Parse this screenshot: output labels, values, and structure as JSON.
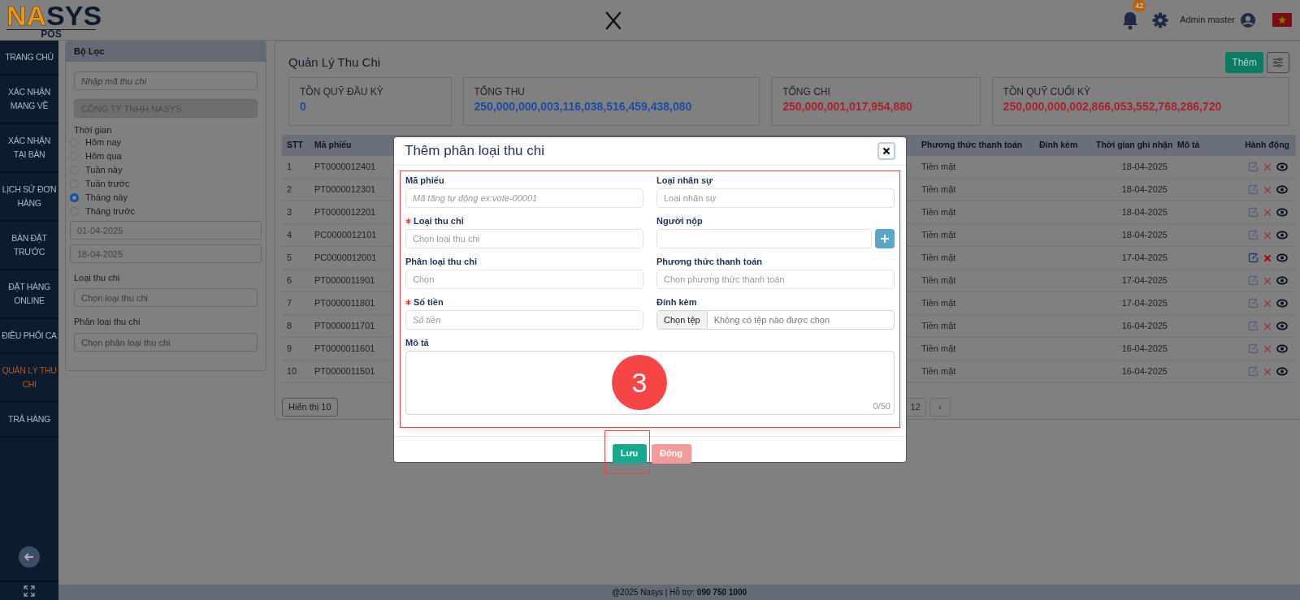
{
  "header": {
    "logo": {
      "wordmark": "NASYS",
      "sub": "POS"
    },
    "notification_count": "42",
    "user_name": "Admin master"
  },
  "sidebar": {
    "items": [
      {
        "label": "TRANG CHỦ",
        "selected": false
      },
      {
        "label": "XÁC NHẬN MANG VỀ",
        "selected": false
      },
      {
        "label": "XÁC NHẬN TẠI BÀN",
        "selected": false
      },
      {
        "label": "LỊCH SỬ ĐƠN HÀNG",
        "selected": false
      },
      {
        "label": "BÀN ĐẶT TRƯỚC",
        "selected": false
      },
      {
        "label": "ĐẶT HÀNG ONLINE",
        "selected": false
      },
      {
        "label": "ĐIỀU PHỐI CA",
        "selected": false
      },
      {
        "label": "QUẢN LÝ THU CHI",
        "selected": true
      },
      {
        "label": "TRẢ HÀNG",
        "selected": false
      }
    ]
  },
  "filter": {
    "title": "Bộ Lọc",
    "code_field": {
      "placeholder": "Nhập mã thu chi"
    },
    "company_field": {
      "value": "CÔNG TY TNHH NASYS",
      "disabled": true
    },
    "time_label": "Thời gian",
    "time_options": [
      {
        "label": "Hôm nay",
        "selected": false
      },
      {
        "label": "Hôm qua",
        "selected": false
      },
      {
        "label": "Tuần này",
        "selected": false
      },
      {
        "label": "Tuần trước",
        "selected": false
      },
      {
        "label": "Tháng này",
        "selected": true
      },
      {
        "label": "Tháng trước",
        "selected": false
      }
    ],
    "date_from": "01-04-2025",
    "date_to": "18-04-2025",
    "type": {
      "label": "Loại thu chi",
      "placeholder": "Chọn loại thu chi"
    },
    "category": {
      "label": "Phân loại thu chi",
      "placeholder": "Chọn phân loại thu chi"
    }
  },
  "main": {
    "title": "Quản Lý Thu Chi",
    "add_button": "Thêm",
    "stats": [
      {
        "label": "TỒN QUỸ ĐẦU KỲ",
        "value": "0",
        "color": "#1b4ea0"
      },
      {
        "label": "TỔNG THU",
        "value": "250,000,000,003,116,038,516,459,438,080",
        "color": "#1b4ea0"
      },
      {
        "label": "TỔNG CHI",
        "value": "250,000,001,017,954,880",
        "color": "#a8242d"
      },
      {
        "label": "TỒN QUỸ CUỐI KỲ",
        "value": "250,000,000,002,866,053,552,768,286,720",
        "color": "#a8242d"
      }
    ],
    "table": {
      "columns": [
        "STT",
        "Mã phiếu",
        "Phương thức thanh toán",
        "Đính kèm",
        "Thời gian ghi nhận",
        "Mô tả",
        "Hành động"
      ],
      "rows": [
        {
          "stt": "1",
          "code": "PT0000012401",
          "payment": "Tiền mặt",
          "recorded": "18-04-2025",
          "hovered": false
        },
        {
          "stt": "2",
          "code": "PT0000012301",
          "payment": "Tiền mặt",
          "recorded": "18-04-2025",
          "hovered": false
        },
        {
          "stt": "3",
          "code": "PT0000012201",
          "payment": "Tiền mặt",
          "recorded": "18-04-2025",
          "hovered": false
        },
        {
          "stt": "4",
          "code": "PC0000012101",
          "payment": "Tiền mặt",
          "recorded": "18-04-2025",
          "hovered": false
        },
        {
          "stt": "5",
          "code": "PC0000012001",
          "payment": "Tiền mặt",
          "recorded": "17-04-2025",
          "hovered": true
        },
        {
          "stt": "6",
          "code": "PT0000011901",
          "payment": "Tiền mặt",
          "recorded": "17-04-2025",
          "hovered": false
        },
        {
          "stt": "7",
          "code": "PT0000011801",
          "payment": "Tiền mặt",
          "recorded": "17-04-2025",
          "hovered": false
        },
        {
          "stt": "8",
          "code": "PT0000011701",
          "payment": "Tiền mặt",
          "recorded": "16-04-2025",
          "hovered": false
        },
        {
          "stt": "9",
          "code": "PT0000011601",
          "payment": "Tiền mặt",
          "recorded": "16-04-2025",
          "hovered": false
        },
        {
          "stt": "10",
          "code": "PT0000011501",
          "payment": "Tiền mặt",
          "recorded": "16-04-2025",
          "hovered": false
        }
      ]
    },
    "page_size": "Hiển thị 10",
    "pagination": [
      "12",
      "›"
    ]
  },
  "modal": {
    "title": "Thêm phân loại thu chi",
    "fields": [
      {
        "kind": "text",
        "label": "Mã phiếu",
        "required": false,
        "placeholder": "Mã tăng tự động ex:vote-00001",
        "italic": true
      },
      {
        "kind": "text",
        "label": "Loại nhân sự",
        "required": false,
        "placeholder": "Loại nhân sự",
        "italic": false
      },
      {
        "kind": "text",
        "label": "Loại thu chi",
        "required": true,
        "placeholder": "Chọn loại thu chi",
        "italic": false
      },
      {
        "kind": "add",
        "label": "Người nộp",
        "required": false
      },
      {
        "kind": "text",
        "label": "Phân loại thu chi",
        "required": false,
        "placeholder": "Chọn",
        "italic": false
      },
      {
        "kind": "text",
        "label": "Phương thức thanh toán",
        "required": false,
        "placeholder": "Chọn phương thức thanh toán",
        "italic": false
      },
      {
        "kind": "text",
        "label": "Số tiền",
        "required": true,
        "placeholder": "Số tiền",
        "italic": true
      },
      {
        "kind": "file",
        "label": "Đính kèm",
        "required": false,
        "button": "Chọn tệp",
        "status": "Không có tệp nào được chọn"
      },
      {
        "kind": "textarea",
        "label": "Mô tả",
        "required": false,
        "counter": "0/50"
      }
    ],
    "save_button": "Lưu",
    "close_button": "Đóng",
    "step_marker": "3"
  },
  "footer": "@2025 Nasys | Hỗ trợ: **090 750 1000**"
}
